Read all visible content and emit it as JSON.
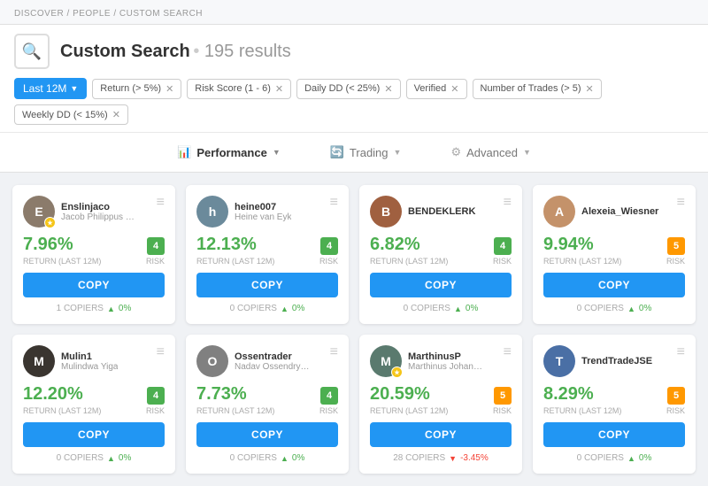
{
  "breadcrumb": "DISCOVER / PEOPLE / CUSTOM SEARCH",
  "header": {
    "title": "Custom Search",
    "results": "195 results"
  },
  "filters": {
    "period_label": "Last 12M",
    "chips": [
      "Return (> 5%)",
      "Risk Score (1 - 6)",
      "Daily DD (< 25%)",
      "Verified",
      "Number of Trades (> 5)",
      "Weekly DD (< 15%)"
    ]
  },
  "tabs": [
    {
      "id": "performance",
      "label": "Performance",
      "icon": "📊",
      "active": true
    },
    {
      "id": "trading",
      "label": "Trading",
      "icon": "🔄",
      "active": false
    },
    {
      "id": "advanced",
      "label": "Advanced",
      "icon": "⚙",
      "active": false
    }
  ],
  "cards": [
    {
      "username": "Enslinjaco",
      "fullname": "Jacob Philippus En...",
      "return": "7.96%",
      "risk": "4",
      "risk_color": "green",
      "return_label": "RETURN (LAST 12M)",
      "risk_label": "RISK",
      "copiers": "1 COPIERS",
      "change": "0%",
      "change_dir": "up",
      "has_star": true,
      "avatar_color": "#8b7355",
      "avatar_letter": "E"
    },
    {
      "username": "heine007",
      "fullname": "Heine van Eyk",
      "return": "12.13%",
      "risk": "4",
      "risk_color": "green",
      "return_label": "RETURN (LAST 12M)",
      "risk_label": "RISK",
      "copiers": "0 COPIERS",
      "change": "0%",
      "change_dir": "up",
      "has_star": false,
      "avatar_color": "#6b8e9f",
      "avatar_letter": "H"
    },
    {
      "username": "BENDEKLERK",
      "fullname": "",
      "return": "6.82%",
      "risk": "4",
      "risk_color": "green",
      "return_label": "RETURN (LAST 12M)",
      "risk_label": "RISK",
      "copiers": "0 COPIERS",
      "change": "0%",
      "change_dir": "up",
      "has_star": false,
      "avatar_color": "#a0522d",
      "avatar_letter": "B"
    },
    {
      "username": "Alexeia_Wiesner",
      "fullname": "",
      "return": "9.94%",
      "risk": "5",
      "risk_color": "yellow",
      "return_label": "RETURN (LAST 12M)",
      "risk_label": "RISK",
      "copiers": "0 COPIERS",
      "change": "0%",
      "change_dir": "up",
      "has_star": false,
      "avatar_color": "#c4956a",
      "avatar_letter": "A"
    },
    {
      "username": "Mulin1",
      "fullname": "Mulindwa Yiga",
      "return": "12.20%",
      "risk": "4",
      "risk_color": "green",
      "return_label": "RETURN (LAST 12M)",
      "risk_label": "RISK",
      "copiers": "0 COPIERS",
      "change": "0%",
      "change_dir": "up",
      "has_star": false,
      "avatar_color": "#7a6e5f",
      "avatar_letter": "M"
    },
    {
      "username": "Ossentrader",
      "fullname": "Nadav Ossendryver",
      "return": "7.73%",
      "risk": "4",
      "risk_color": "green",
      "return_label": "RETURN (LAST 12M)",
      "risk_label": "RISK",
      "copiers": "0 COPIERS",
      "change": "0%",
      "change_dir": "up",
      "has_star": false,
      "avatar_color": "#888",
      "avatar_letter": "O"
    },
    {
      "username": "MarthinusP",
      "fullname": "Marthinus Johann...",
      "return": "20.59%",
      "risk": "5",
      "risk_color": "yellow",
      "return_label": "RETURN (LAST 12M)",
      "risk_label": "RISK",
      "copiers": "28 COPIERS",
      "change": "-3.45%",
      "change_dir": "down",
      "has_star": true,
      "avatar_color": "#5a7a6e",
      "avatar_letter": "M"
    },
    {
      "username": "TrendTradeJSE",
      "fullname": "",
      "return": "8.29%",
      "risk": "5",
      "risk_color": "yellow",
      "return_label": "RETURN (LAST 12M)",
      "risk_label": "RISK",
      "copiers": "0 COPIERS",
      "change": "0%",
      "change_dir": "up",
      "has_star": false,
      "avatar_color": "#4a6fa5",
      "avatar_letter": "T"
    }
  ],
  "copy_label": "COPY",
  "avatar_colors": {
    "Enslinjaco": "#8b7355",
    "heine007": "#5a8a9e",
    "BENDEKLERK": "#a0522d",
    "Alexeia_Wiesner": "#d4956a",
    "Mulin1": "#3a3a3a",
    "Ossentrader": "#888",
    "MarthinusP": "#5a7a6e",
    "TrendTradeJSE": "#4a6fa5"
  }
}
